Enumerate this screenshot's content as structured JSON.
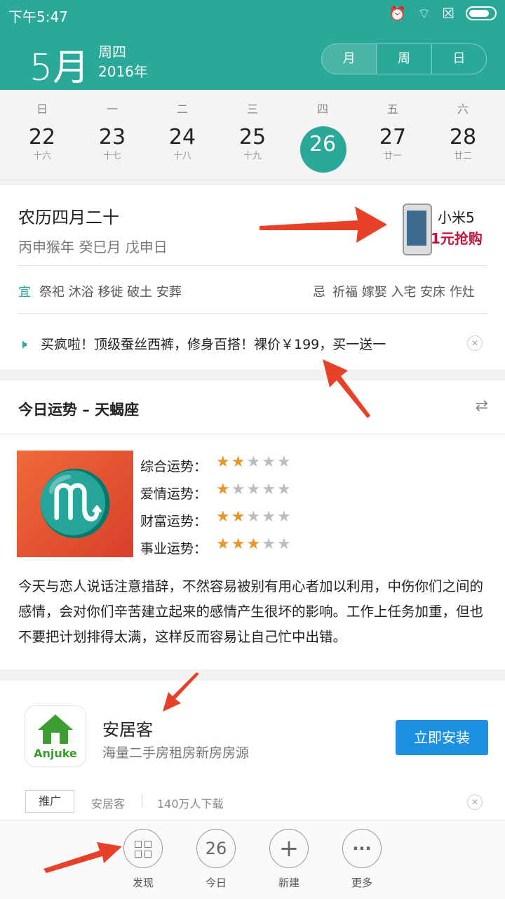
{
  "status": {
    "time": "下午5:47"
  },
  "header": {
    "month": "5月",
    "weekday": "周四",
    "year": "2016年",
    "view_tabs": [
      "月",
      "周",
      "日"
    ]
  },
  "week": {
    "headers": [
      "日",
      "一",
      "二",
      "三",
      "四",
      "五",
      "六"
    ],
    "days": [
      {
        "num": "22",
        "lunar": "十六"
      },
      {
        "num": "23",
        "lunar": "十七"
      },
      {
        "num": "24",
        "lunar": "十八"
      },
      {
        "num": "25",
        "lunar": "十九"
      },
      {
        "num": "26",
        "lunar": ""
      },
      {
        "num": "27",
        "lunar": "廿一"
      },
      {
        "num": "28",
        "lunar": "廿二"
      }
    ],
    "selected_index": 4
  },
  "almanac": {
    "lunar_date": "农历四月二十",
    "ganzhi": "丙申猴年 癸巳月 戊申日",
    "yi_label": "宜",
    "yi_items": "祭祀 沐浴 移徙 破土 安葬",
    "ji_label": "忌",
    "ji_items": "祈福 嫁娶 入宅 安床 作灶",
    "ad": {
      "line1": "小米5",
      "line2": "1元抢购"
    },
    "promo": "买疯啦！顶级蚕丝西裤，修身百搭！裸价￥199，买一送一"
  },
  "fortune": {
    "title": "今日运势 – 天蝎座",
    "symbol": "♏",
    "rows": [
      {
        "label": "综合运势：",
        "stars": 2
      },
      {
        "label": "爱情运势：",
        "stars": 1
      },
      {
        "label": "财富运势：",
        "stars": 2
      },
      {
        "label": "事业运势：",
        "stars": 3
      }
    ],
    "description": "今天与恋人说话注意措辞，不然容易被别有用心者加以利用，中伤你们之间的感情，会对你们辛苦建立起来的感情产生很坏的影响。工作上任务加重，但也不要把计划排得太满，这样反而容易让自己忙中出错。"
  },
  "app_ad": {
    "icon_word": "Anjuke",
    "name": "安居客",
    "desc": "海量二手房租房新房房源",
    "install": "立即安装",
    "tag": "推广",
    "publisher": "安居客",
    "downloads": "140万人下载"
  },
  "bottom": [
    {
      "label": "发现",
      "icon": "grid-icon"
    },
    {
      "label": "今日",
      "icon": "26"
    },
    {
      "label": "新建",
      "icon": "+"
    },
    {
      "label": "更多",
      "icon": "···"
    }
  ],
  "colors": {
    "teal": "#2aa898",
    "install": "#1e90e0",
    "star_on": "#e8962b",
    "arrow": "#e8412a"
  }
}
